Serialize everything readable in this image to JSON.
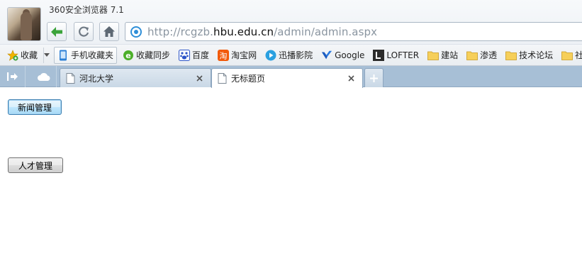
{
  "window": {
    "app_title": "360安全浏览器 7.1"
  },
  "address_bar": {
    "url_prefix": "http://rcgzb.",
    "url_domain": "hbu.edu.cn",
    "url_path": "/admin/admin.aspx"
  },
  "bookmarks": {
    "items": [
      {
        "label": "收藏",
        "icon": "star-add-icon"
      },
      {
        "label": "手机收藏夹",
        "icon": "phone-icon"
      },
      {
        "label": "收藏同步",
        "icon": "sync-e-icon"
      },
      {
        "label": "百度",
        "icon": "baidu-paw-icon"
      },
      {
        "label": "淘宝网",
        "icon": "taobao-icon"
      },
      {
        "label": "迅播影院",
        "icon": "play-icon"
      },
      {
        "label": "Google",
        "icon": "google-icon"
      },
      {
        "label": "LOFTER",
        "icon": "lofter-icon"
      },
      {
        "label": "建站",
        "icon": "folder-icon"
      },
      {
        "label": "渗透",
        "icon": "folder-icon"
      },
      {
        "label": "技术论坛",
        "icon": "folder-icon"
      },
      {
        "label": "社工",
        "icon": "folder-icon"
      }
    ]
  },
  "tabs": [
    {
      "label": "河北大学",
      "active": false
    },
    {
      "label": "无标题页",
      "active": true
    }
  ],
  "page": {
    "news_button": "新闻管理",
    "talent_button": "人才管理"
  },
  "colors": {
    "tabbar_bg": "#a7bfd6",
    "nav_green": "#3aa33a"
  }
}
